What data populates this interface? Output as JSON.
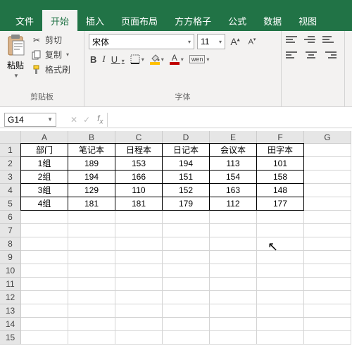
{
  "tabs": {
    "file": "文件",
    "home": "开始",
    "insert": "插入",
    "layout": "页面布局",
    "fangfang": "方方格子",
    "formulas": "公式",
    "data": "数据",
    "view": "视图"
  },
  "clipboard": {
    "paste": "粘贴",
    "cut": "剪切",
    "copy": "复制",
    "format_painter": "格式刷",
    "group_label": "剪贴板"
  },
  "font": {
    "name": "宋体",
    "size": "11",
    "bold": "B",
    "italic": "I",
    "underline": "U",
    "wen": "wen",
    "group_label": "字体"
  },
  "namebox": {
    "ref": "G14"
  },
  "chart_data": {
    "type": "table",
    "columns": [
      "A",
      "B",
      "C",
      "D",
      "E",
      "F"
    ],
    "headers": [
      "部门",
      "笔记本",
      "日程本",
      "日记本",
      "会议本",
      "田字本"
    ],
    "rows": [
      [
        "1组",
        189,
        153,
        194,
        113,
        101
      ],
      [
        "2组",
        194,
        166,
        151,
        154,
        158
      ],
      [
        "3组",
        129,
        110,
        152,
        163,
        148
      ],
      [
        "4组",
        181,
        181,
        179,
        112,
        177
      ]
    ]
  },
  "row_numbers": [
    "1",
    "2",
    "3",
    "4",
    "5",
    "6",
    "7",
    "8",
    "9",
    "10",
    "11",
    "12",
    "13",
    "14",
    "15"
  ]
}
